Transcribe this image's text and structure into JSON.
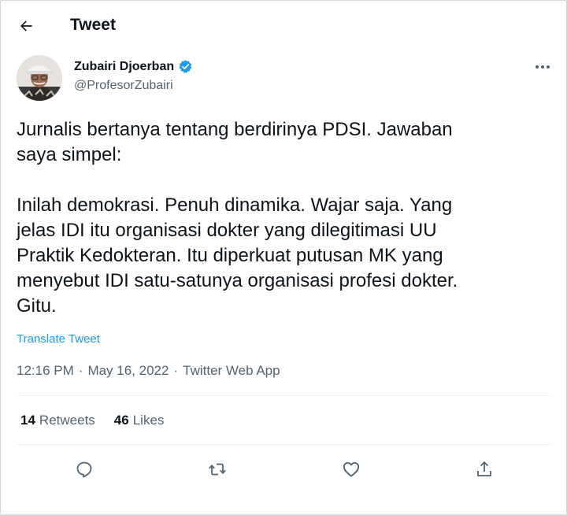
{
  "header": {
    "title": "Tweet",
    "back_icon": "arrow-left-icon"
  },
  "author": {
    "name": "Zubairi Djoerban",
    "handle": "@ProfesorZubairi",
    "verified": true,
    "verified_color": "#1d9bf0"
  },
  "tweet": {
    "lines": [
      "Jurnalis bertanya tentang berdirinya PDSI. Jawaban",
      "saya simpel:",
      "",
      "Inilah demokrasi. Penuh dinamika. Wajar saja. Yang",
      "jelas IDI itu organisasi dokter yang dilegitimasi UU",
      "Praktik Kedokteran. Itu diperkuat putusan MK yang",
      "menyebut IDI satu-satunya organisasi profesi dokter.",
      "Gitu."
    ],
    "translate_label": "Translate Tweet"
  },
  "meta": {
    "time": "12:16 PM",
    "separator": "·",
    "date": "May 16, 2022",
    "app": "Twitter Web App"
  },
  "stats": {
    "retweets_count": "14",
    "retweets_label": "Retweets",
    "likes_count": "46",
    "likes_label": "Likes"
  },
  "actions": [
    "reply-icon",
    "retweet-icon",
    "like-icon",
    "share-icon"
  ],
  "colors": {
    "accent": "#1d9bf0",
    "text": "#0f1419",
    "secondary": "#536471",
    "border": "#eff3f4"
  }
}
